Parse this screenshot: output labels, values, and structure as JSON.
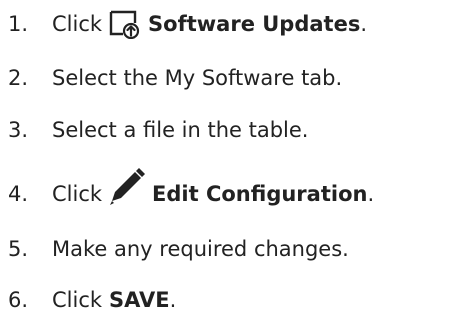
{
  "steps": [
    {
      "number": "1.",
      "prefix": "Click",
      "icon": "software-update-icon",
      "bold": "Software Updates",
      "suffix": "."
    },
    {
      "number": "2.",
      "text": "Select the My Software tab."
    },
    {
      "number": "3.",
      "text": "Select a file in the table."
    },
    {
      "number": "4.",
      "prefix": "Click",
      "icon": "pencil-edit-icon",
      "bold": "Edit Configuration",
      "suffix": "."
    },
    {
      "number": "5.",
      "text": "Make any required changes."
    },
    {
      "number": "6.",
      "prefix": "Click",
      "bold": "SAVE",
      "suffix": "."
    }
  ],
  "colors": {
    "text": "#222222",
    "icon": "#222222"
  }
}
